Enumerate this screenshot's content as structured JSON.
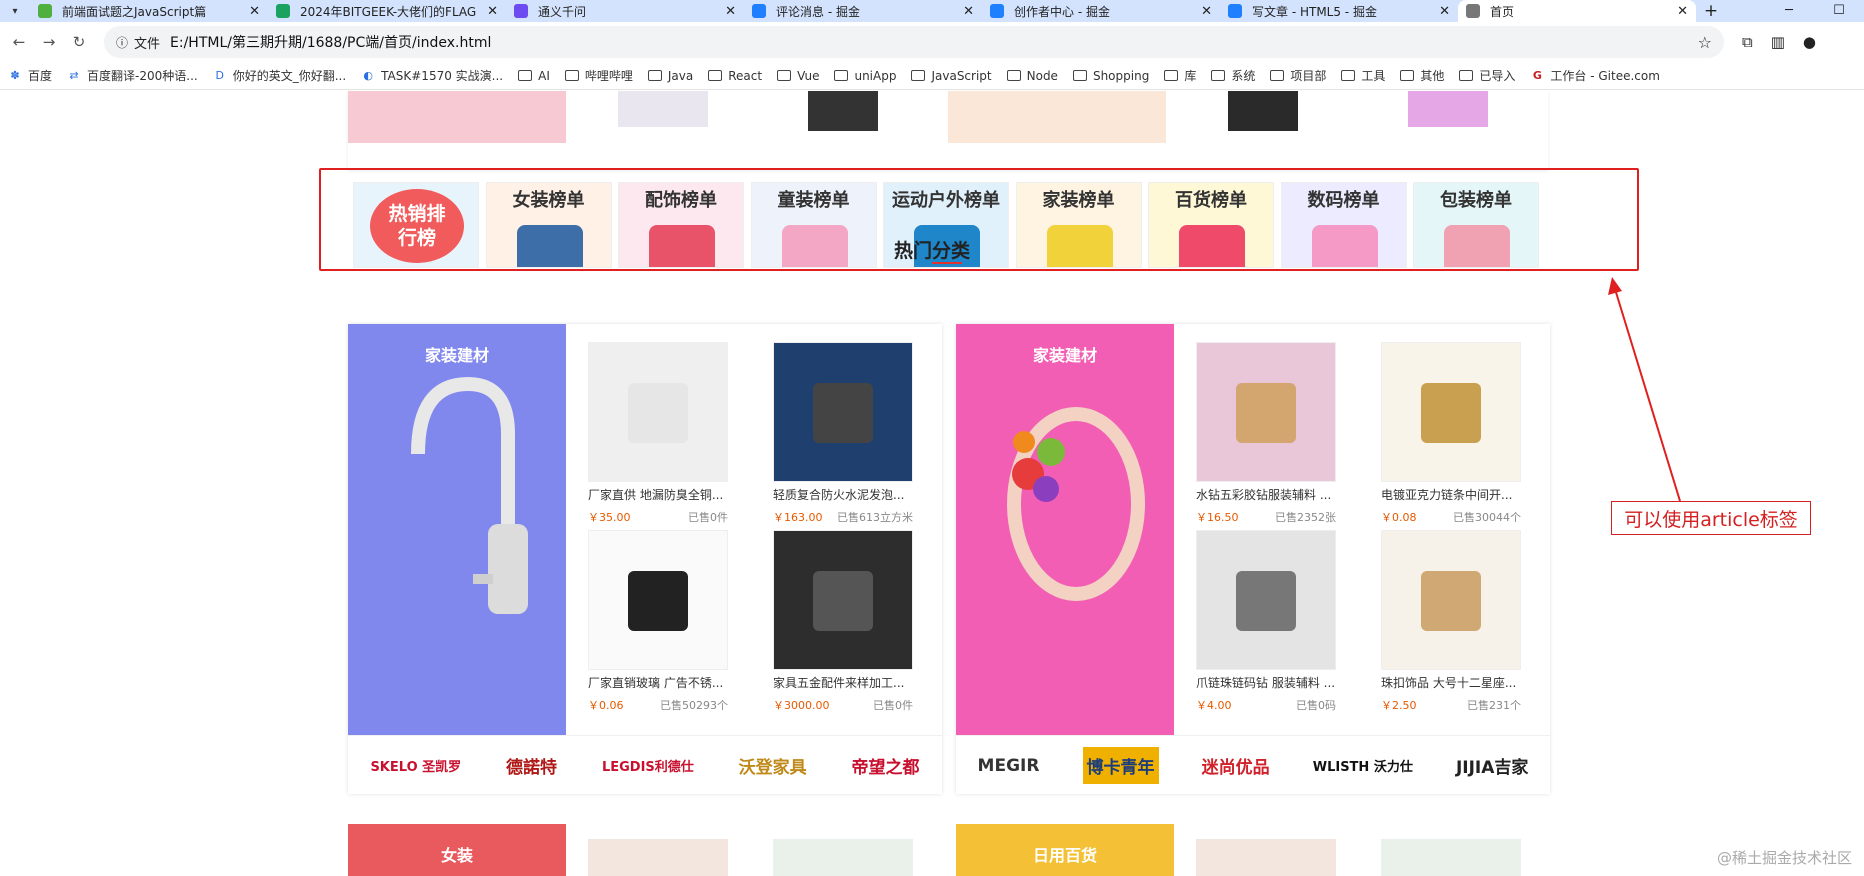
{
  "browser": {
    "tabs": [
      {
        "title": "前端面试题之JavaScript篇",
        "color": "#4fb040"
      },
      {
        "title": "2024年BITGEEK-大佬们的FLAG",
        "color": "#1aa260"
      },
      {
        "title": "通义千问",
        "color": "#6c4cf0"
      },
      {
        "title": "评论消息 - 掘金",
        "color": "#1e80ff"
      },
      {
        "title": "创作者中心 - 掘金",
        "color": "#1e80ff"
      },
      {
        "title": "写文章 - HTML5 - 掘金",
        "color": "#1e80ff"
      },
      {
        "title": "首页",
        "color": "#777777"
      }
    ],
    "address": {
      "security_label": "文件",
      "url": "E:/HTML/第三期升期/1688/PC端/首页/index.html"
    },
    "bookmarks": [
      "百度",
      "百度翻译-200种语...",
      "你好的英文_你好翻...",
      "TASK#1570 实战演...",
      "AI",
      "哔哩哔哩",
      "Java",
      "React",
      "Vue",
      "uniApp",
      "JavaScript",
      "Node",
      "Shopping",
      "库",
      "系统",
      "项目部",
      "工具",
      "其他",
      "已导入",
      "工作台 - Gitee.com"
    ]
  },
  "ranking": {
    "items": [
      {
        "label": "热销排行榜",
        "bg": "#e8f4fb",
        "accent": "#f25b5b"
      },
      {
        "label": "女装榜单",
        "bg": "#fff1e6",
        "accent": "#3e6ea8"
      },
      {
        "label": "配饰榜单",
        "bg": "#fde8ef",
        "accent": "#e9536a"
      },
      {
        "label": "童装榜单",
        "bg": "#eef3fb",
        "accent": "#f4a7c5"
      },
      {
        "label": "运动户外榜单",
        "bg": "#e1f1fc",
        "accent": "#1e86c9"
      },
      {
        "label": "家装榜单",
        "bg": "#fff3e2",
        "accent": "#f2d23a"
      },
      {
        "label": "百货榜单",
        "bg": "#fff8d7",
        "accent": "#f04a6a"
      },
      {
        "label": "数码榜单",
        "bg": "#ecebff",
        "accent": "#f59ac7"
      },
      {
        "label": "包装榜单",
        "bg": "#e4f6f8",
        "accent": "#f0a2b2"
      }
    ]
  },
  "hot_category": {
    "title": "热门分类"
  },
  "panels": [
    {
      "category": "家装建材",
      "color": "#8088ee",
      "products": [
        {
          "name": "厂家直供 地漏防臭全铜...",
          "price": "￥35.00",
          "sold": "已售0件"
        },
        {
          "name": "轻质复合防火水泥发泡...",
          "price": "￥163.00",
          "sold": "已售613立方米"
        },
        {
          "name": "厂家直销玻璃 广告不锈...",
          "price": "￥0.06",
          "sold": "已售50293个"
        },
        {
          "name": "家具五金配件来样加工...",
          "price": "￥3000.00",
          "sold": "已售0件"
        }
      ],
      "brands": [
        "SKELO 圣凯罗",
        "德諾特",
        "LEGDIS利德仕",
        "沃登家具",
        "帝望之都"
      ]
    },
    {
      "category": "家装建材",
      "color": "#f25eb4",
      "products": [
        {
          "name": "水钻五彩胶钻服装辅料 ...",
          "price": "￥16.50",
          "sold": "已售2352张"
        },
        {
          "name": "电镀亚克力链条中间开...",
          "price": "￥0.08",
          "sold": "已售30044个"
        },
        {
          "name": "爪链珠链码钻 服装辅料 ...",
          "price": "￥4.00",
          "sold": "已售0码"
        },
        {
          "name": "珠扣饰品 大号十二星座...",
          "price": "￥2.50",
          "sold": "已售231个"
        }
      ],
      "brands": [
        "MEGIR",
        "博卡青年",
        "迷尚优品",
        "WLISTH 沃力仕",
        "JIJIA吉家"
      ]
    }
  ],
  "next_panels": [
    {
      "category": "女装",
      "color": "#e85a5e"
    },
    {
      "category": "日用百货",
      "color": "#f4c035"
    }
  ],
  "annotation": {
    "text": "可以使用article标签",
    "color": "#d32020"
  },
  "watermark": "@稀土掘金技术社区"
}
